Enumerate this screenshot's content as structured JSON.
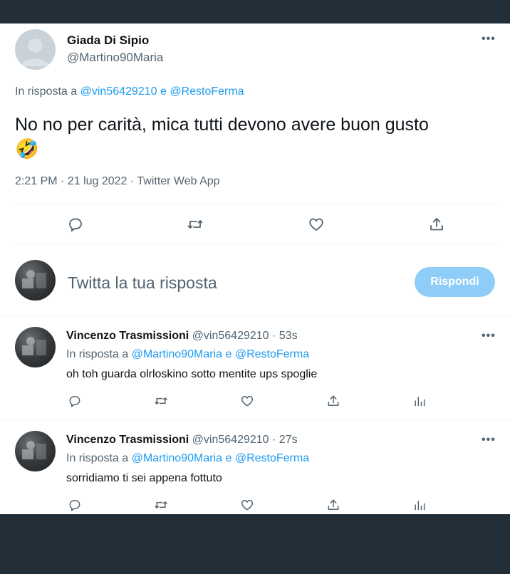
{
  "tweet": {
    "author_name": "Giada Di Sipio",
    "author_handle": "@Martino90Maria",
    "more_label": "•••",
    "reply_to_prefix": "In risposta a",
    "reply_to_user1": "@vin56429210",
    "reply_to_sep": "e",
    "reply_to_user2": "@RestoFerma",
    "text": "No no per carità, mica tutti devono avere buon gusto",
    "emoji": "🤣",
    "timestamp": "2:21 PM · 21 lug 2022 · Twitter Web App"
  },
  "compose": {
    "placeholder": "Twitta la tua risposta",
    "button_label": "Rispondi"
  },
  "replies": [
    {
      "author_name": "Vincenzo Trasmissioni",
      "meta": "@vin56429210 · 53s",
      "reply_to_prefix": "In risposta a",
      "reply_to_user1": "@Martino90Maria",
      "reply_to_sep": "e",
      "reply_to_user2": "@RestoFerma",
      "text": "oh toh guarda olrloskino sotto mentite ups spoglie",
      "more_label": "•••"
    },
    {
      "author_name": "Vincenzo Trasmissioni",
      "meta": "@vin56429210 · 27s",
      "reply_to_prefix": "In risposta a",
      "reply_to_user1": "@Martino90Maria",
      "reply_to_sep": "e",
      "reply_to_user2": "@RestoFerma",
      "text": "sorridiamo ti sei appena fottuto",
      "more_label": "•••"
    }
  ],
  "colors": {
    "accent": "#1d9bf0",
    "button_disabled": "#8ecdf8",
    "text": "#0f1419",
    "secondary_text": "#536471",
    "background_frame": "#222e38"
  }
}
